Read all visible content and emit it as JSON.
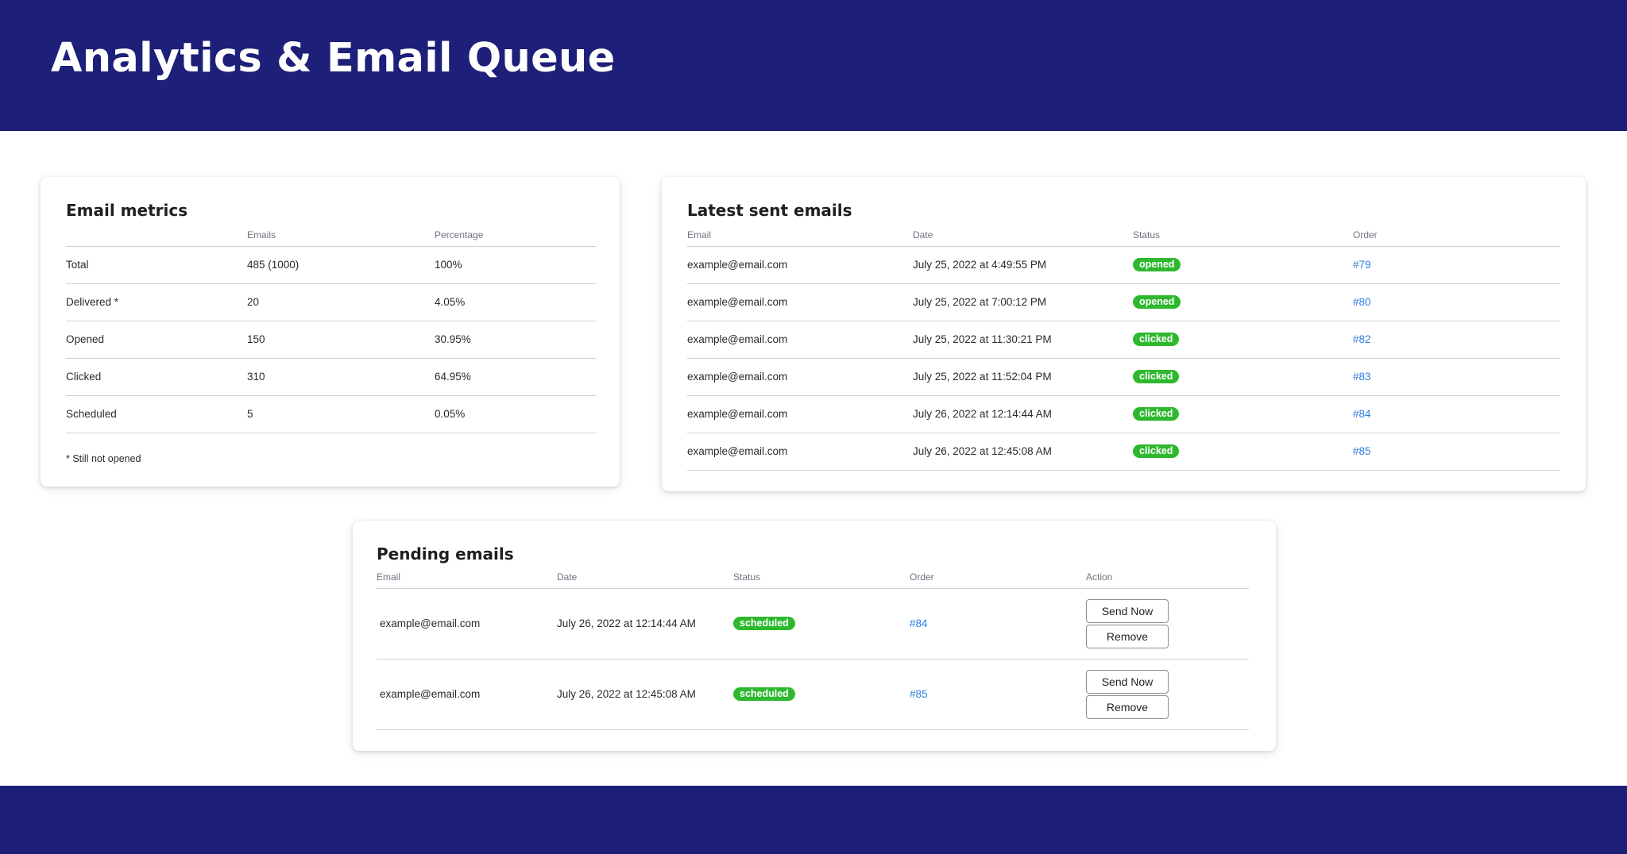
{
  "header": {
    "title": "Analytics & Email Queue"
  },
  "metrics": {
    "title": "Email metrics",
    "columns": [
      "",
      "Emails",
      "Percentage"
    ],
    "rows": [
      {
        "label": "Total",
        "emails": "485 (1000)",
        "percentage": "100%"
      },
      {
        "label": "Delivered *",
        "emails": "20",
        "percentage": "4.05%"
      },
      {
        "label": "Opened",
        "emails": "150",
        "percentage": "30.95%"
      },
      {
        "label": "Clicked",
        "emails": "310",
        "percentage": "64.95%"
      },
      {
        "label": "Scheduled",
        "emails": "5",
        "percentage": "0.05%"
      }
    ],
    "footnote": "* Still not opened"
  },
  "sent": {
    "title": "Latest sent emails",
    "columns": [
      "Email",
      "Date",
      "Status",
      "Order"
    ],
    "rows": [
      {
        "email": "example@email.com",
        "date": "July 25, 2022 at 4:49:55 PM",
        "status": "opened",
        "order": "#79"
      },
      {
        "email": "example@email.com",
        "date": "July 25, 2022 at 7:00:12 PM",
        "status": "opened",
        "order": "#80"
      },
      {
        "email": "example@email.com",
        "date": "July 25, 2022 at 11:30:21 PM",
        "status": "clicked",
        "order": "#82"
      },
      {
        "email": "example@email.com",
        "date": "July 25, 2022 at 11:52:04 PM",
        "status": "clicked",
        "order": "#83"
      },
      {
        "email": "example@email.com",
        "date": "July 26, 2022 at 12:14:44 AM",
        "status": "clicked",
        "order": "#84"
      },
      {
        "email": "example@email.com",
        "date": "July 26, 2022 at 12:45:08 AM",
        "status": "clicked",
        "order": "#85"
      }
    ]
  },
  "pending": {
    "title": "Pending emails",
    "columns": [
      "Email",
      "Date",
      "Status",
      "Order",
      "Action"
    ],
    "rows": [
      {
        "email": "example@email.com",
        "date": "July 26, 2022 at 12:14:44 AM",
        "status": "scheduled",
        "order": "#84",
        "send_label": "Send Now",
        "remove_label": "Remove"
      },
      {
        "email": "example@email.com",
        "date": "July 26, 2022 at 12:45:08 AM",
        "status": "scheduled",
        "order": "#85",
        "send_label": "Send Now",
        "remove_label": "Remove"
      }
    ]
  },
  "colors": {
    "banner": "#1d1f78",
    "status_badge": "#2eb82e",
    "link": "#2d7fe0"
  }
}
